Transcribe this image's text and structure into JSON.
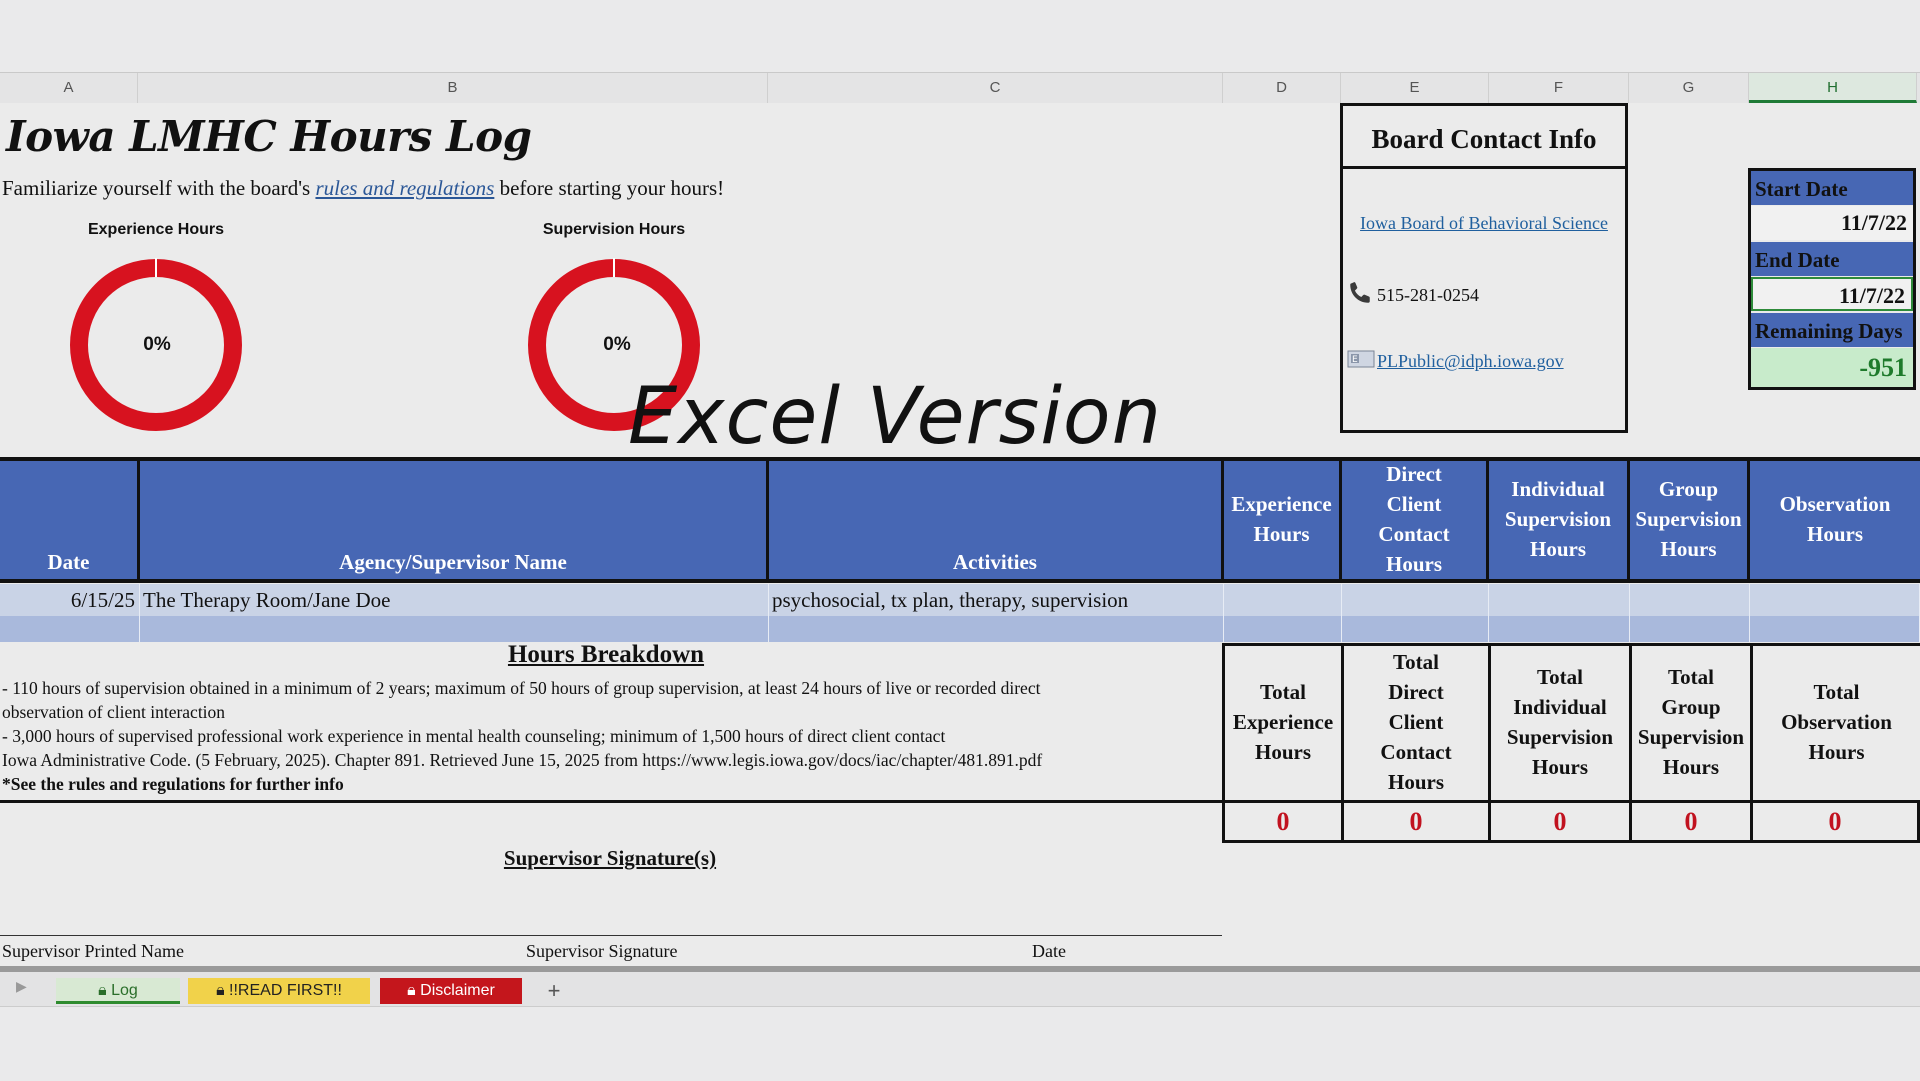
{
  "columns": [
    "A",
    "B",
    "C",
    "D",
    "E",
    "F",
    "G",
    "H"
  ],
  "sheet": {
    "title": "Iowa LMHC Hours Log",
    "subtitle_pre": "Familiarize yourself with the board's ",
    "subtitle_link": "rules and regulations",
    "subtitle_post": " before starting your hours!",
    "overlay_text": "Excel Version"
  },
  "donuts": [
    {
      "label": "Experience Hours",
      "percent": "0%",
      "value": 0,
      "ring_color": "#d7121f"
    },
    {
      "label": "Supervision Hours",
      "percent": "0%",
      "value": 0,
      "ring_color": "#d7121f"
    }
  ],
  "contact": {
    "title": "Board Contact Info",
    "board_link": "Iowa Board of Behavioral Science",
    "phone": "515-281-0254",
    "email": "PLPublic@idph.iowa.gov",
    "phone_icon": "phone-icon",
    "email_icon": "email-icon"
  },
  "dates": {
    "start_label": "Start Date",
    "start_value": "11/7/22",
    "end_label": "End Date",
    "end_value": "11/7/22",
    "remaining_label": "Remaining Days",
    "remaining_value": "-951"
  },
  "table": {
    "headers": {
      "date": "Date",
      "agency": "Agency/Supervisor Name",
      "activities": "Activities",
      "experience": [
        "Experience",
        "Hours"
      ],
      "direct": [
        "Direct",
        "Client",
        "Contact",
        "Hours"
      ],
      "individual": [
        "Individual",
        "Supervision",
        "Hours"
      ],
      "group": [
        "Group",
        "Supervision",
        "Hours"
      ],
      "observation": [
        "Observation",
        "Hours"
      ]
    },
    "rows": [
      {
        "date": "6/15/25",
        "agency": "The Therapy Room/Jane Doe",
        "activities": "psychosocial, tx plan, therapy, supervision"
      }
    ]
  },
  "breakdown": {
    "title": "Hours Breakdown",
    "lines": [
      "- 110 hours of supervision obtained in a minimum of 2 years; maximum of 50 hours of group supervision, at least 24 hours of live or recorded direct",
      "observation of client interaction",
      "- 3,000 hours of supervised professional work experience in mental health counseling; minimum of 1,500 hours of direct client contact",
      "Iowa Administrative Code. (5 February, 2025). Chapter 891.  Retrieved June 15, 2025 from https://www.legis.iowa.gov/docs/iac/chapter/481.891.pdf",
      "*See the rules and regulations for further info"
    ]
  },
  "totals": {
    "headers": [
      [
        "Total",
        "Experience",
        "Hours"
      ],
      [
        "Total",
        "Direct",
        "Client",
        "Contact",
        "Hours"
      ],
      [
        "Total",
        "Individual",
        "Supervision",
        "Hours"
      ],
      [
        "Total",
        "Group",
        "Supervision",
        "Hours"
      ],
      [
        "Total",
        "Observation",
        "Hours"
      ]
    ],
    "values": [
      "0",
      "0",
      "0",
      "0",
      "0"
    ]
  },
  "signature": {
    "title": "Supervisor Signature(s)",
    "printed_name": "Supervisor Printed Name",
    "signature": "Supervisor Signature",
    "date": "Date"
  },
  "tabs": {
    "log": "Log",
    "read_first": "!!READ FIRST!!",
    "disclaimer": "Disclaimer",
    "add": "+"
  },
  "colors": {
    "header_blue": "#4767b4",
    "row_light": "#c9d3e6",
    "row_mid": "#a9b9dc",
    "total_red": "#c1121f",
    "remaining_green": "#1e7a2b"
  }
}
